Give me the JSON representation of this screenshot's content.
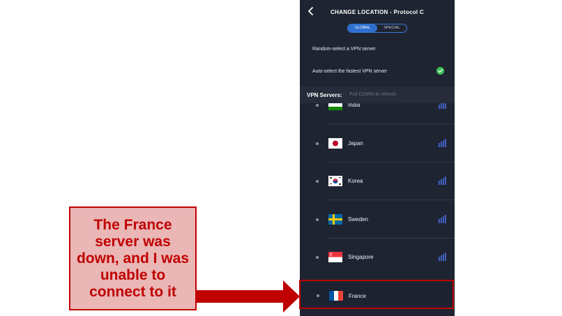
{
  "header": {
    "title": "CHANGE LOCATION - Protocol C",
    "back_icon": "chevron-left-icon"
  },
  "tabs": [
    {
      "label": "GLOBAL",
      "selected": true
    },
    {
      "label": "SPECIAL",
      "selected": false
    }
  ],
  "options": [
    {
      "label": "Random-select a VPN server",
      "selected": false
    },
    {
      "label": "Auto-select the fastest VPN server",
      "selected": true,
      "icon": "check-circle-icon"
    }
  ],
  "servers_header": {
    "title": "VPN Servers:",
    "hint": "Pull DOWN to refresh"
  },
  "servers": [
    {
      "name": "India",
      "flag": "india-flag-icon",
      "signal": "signal-bars-icon"
    },
    {
      "name": "Japan",
      "flag": "japan-flag-icon",
      "signal": "signal-bars-icon"
    },
    {
      "name": "Korea",
      "flag": "korea-flag-icon",
      "signal": "signal-bars-icon"
    },
    {
      "name": "Sweden",
      "flag": "sweden-flag-icon",
      "signal": "signal-bars-icon"
    },
    {
      "name": "Singapore",
      "flag": "singapore-flag-icon",
      "signal": "signal-bars-icon"
    },
    {
      "name": "France",
      "flag": "france-flag-icon",
      "highlighted": true
    }
  ],
  "annotation": {
    "text": "The France\nserver was\ndown, and I was\nunable to\nconnect to it"
  },
  "colors": {
    "panel_bg": "#1f2433",
    "accent": "#2f6fd0",
    "annotation_red": "#c00000",
    "annotation_fill": "#eab6b6",
    "check_green": "#3fbf55"
  }
}
